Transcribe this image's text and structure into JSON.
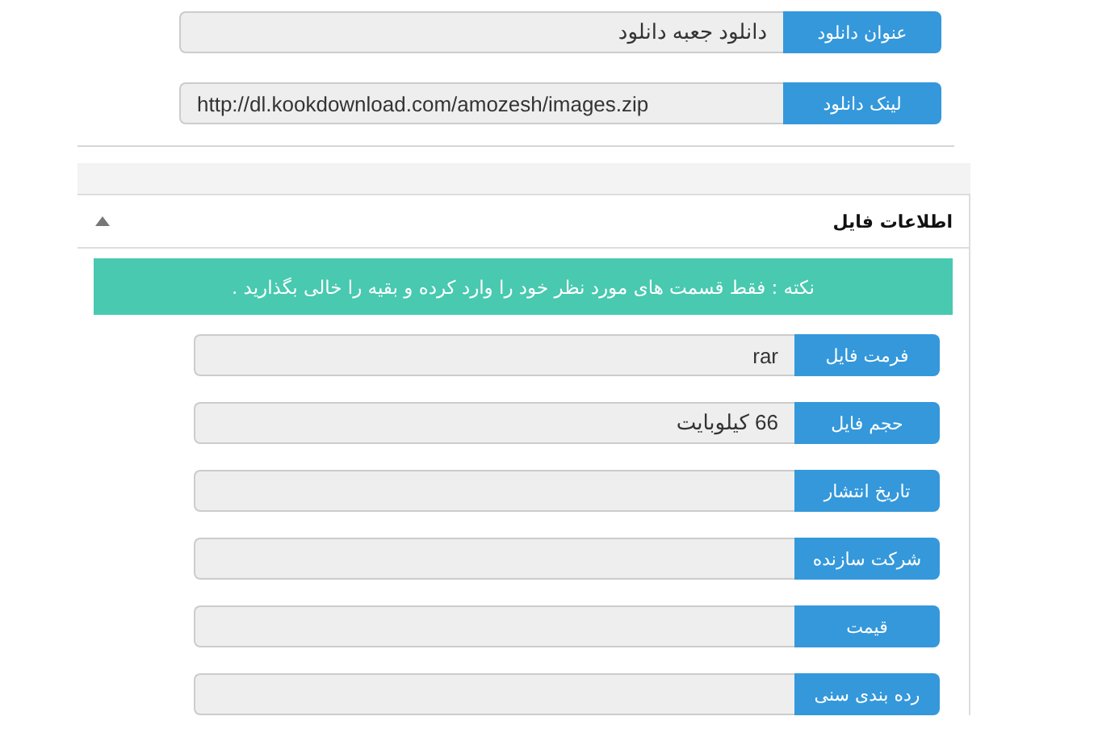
{
  "download_fields": [
    {
      "label": "عنوان دانلود",
      "value": "دانلود جعبه دانلود"
    },
    {
      "label": "لینک دانلود",
      "value": "http://dl.kookdownload.com/amozesh/images.zip"
    }
  ],
  "file_info": {
    "title": "اطلاعات فایل",
    "expanded": true,
    "note": "نکته : فقط قسمت های مورد نظر خود را وارد کرده و بقیه را خالی بگذارید .",
    "fields": [
      {
        "label": "فرمت فایل",
        "value": "rar"
      },
      {
        "label": "حجم فایل",
        "value": "66 کیلوبایت"
      },
      {
        "label": "تاریخ انتشار"
      },
      {
        "label": "شرکت سازنده"
      },
      {
        "label": "قیمت"
      },
      {
        "label": "رده بندی سنی"
      }
    ]
  }
}
